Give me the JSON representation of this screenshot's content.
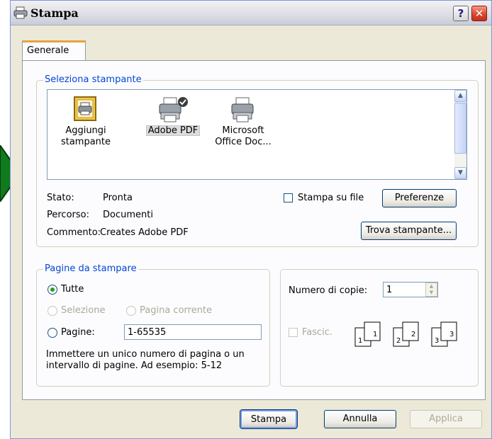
{
  "window": {
    "title": "Stampa"
  },
  "titlebar_buttons": {
    "help": "?",
    "close": "✕"
  },
  "tabs": [
    {
      "label": "Generale",
      "active": true
    }
  ],
  "select_printer": {
    "legend": "Seleziona stampante",
    "printers": [
      {
        "label_line1": "Aggiungi",
        "label_line2": "stampante",
        "icon": "add-printer-icon"
      },
      {
        "label_line1": "Adobe PDF",
        "label_line2": "",
        "icon": "printer-default-icon",
        "selected": true
      },
      {
        "label_line1": "Microsoft",
        "label_line2": "Office Doc...",
        "icon": "printer-icon"
      }
    ],
    "status_label": "Stato:",
    "status_value": "Pronta",
    "path_label": "Percorso:",
    "path_value": "Documenti",
    "comment_label": "Commento:",
    "comment_value": "Creates Adobe PDF",
    "print_to_file_label": "Stampa su file",
    "preferences_button": "Preferenze",
    "find_printer_button": "Trova stampante..."
  },
  "page_range": {
    "legend": "Pagine da stampare",
    "all_label": "Tutte",
    "selection_label": "Selezione",
    "current_page_label": "Pagina corrente",
    "pages_label": "Pagine:",
    "pages_value": "1-65535",
    "hint_line1": "Immettere un unico numero di pagina o un",
    "hint_line2": "intervallo di pagine. Ad esempio: 5-12"
  },
  "copies": {
    "label": "Numero di copie:",
    "value": "1",
    "collate_label": "Fascic."
  },
  "footer_buttons": {
    "print": "Stampa",
    "cancel": "Annulla",
    "apply": "Applica"
  },
  "colors": {
    "arrow": "#0f7a1e",
    "legend_text": "#0046d5",
    "dialog_bg": "#ece9d8"
  }
}
